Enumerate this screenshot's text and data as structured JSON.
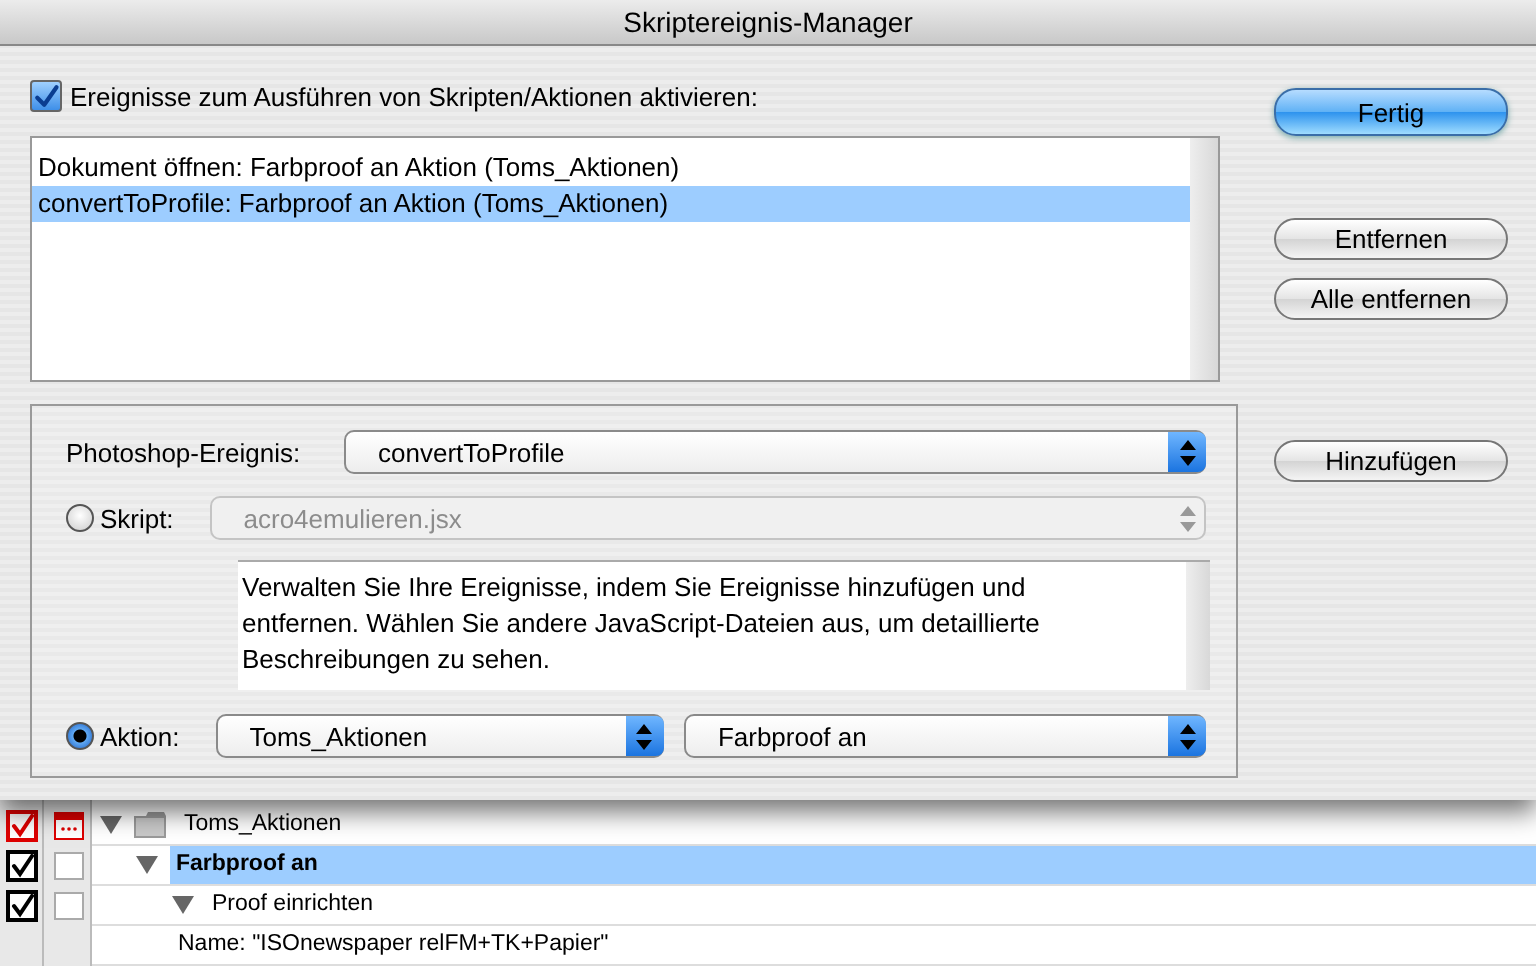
{
  "window": {
    "title": "Skriptereignis-Manager"
  },
  "enable": {
    "label": "Ereignisse zum Ausführen von Skripten/Aktionen aktivieren:",
    "checked": true
  },
  "events": [
    {
      "text": "Dokument öffnen: Farbproof an Aktion (Toms_Aktionen)",
      "selected": false
    },
    {
      "text": "convertToProfile: Farbproof an Aktion (Toms_Aktionen)",
      "selected": true
    }
  ],
  "buttons": [
    {
      "label": "Fertig",
      "kind": "default"
    },
    {
      "label": "Entfernen",
      "kind": "normal"
    },
    {
      "label": "Alle entfernen",
      "kind": "normal"
    },
    {
      "label": "Hinzufügen",
      "kind": "normal"
    }
  ],
  "event_field": {
    "label": "Photoshop-Ereignis:",
    "value": "convertToProfile"
  },
  "script": {
    "label": "Skript:",
    "selected": false,
    "value": "acro4emulieren.jsx",
    "disabled": true
  },
  "description": "Verwalten Sie Ihre Ereignisse, indem Sie Ereignisse hinzufügen und entfernen. Wählen Sie andere JavaScript-Dateien aus, um detaillierte Beschreibungen zu sehen.",
  "action": {
    "label": "Aktion:",
    "selected": true,
    "set": "Toms_Aktionen",
    "action_name": "Farbproof an"
  },
  "actions_panel": {
    "items": [
      {
        "kind": "set",
        "text": "Toms_Aktionen",
        "checked": true,
        "color": "#dd0000",
        "dialog": true,
        "expanded": true,
        "selected": false,
        "children": [
          {
            "kind": "action",
            "text": "Farbproof an",
            "checked": true,
            "color": "#000000",
            "dialog": false,
            "expanded": true,
            "selected": true,
            "children": [
              {
                "kind": "command",
                "text": "Proof einrichten",
                "checked": true,
                "color": "#000000",
                "dialog": false,
                "expanded": true,
                "selected": false,
                "children": [
                  {
                    "kind": "parameter",
                    "text": "Name:  \"ISOnewspaper relFM+TK+Papier\""
                  }
                ]
              }
            ]
          }
        ]
      }
    ]
  }
}
